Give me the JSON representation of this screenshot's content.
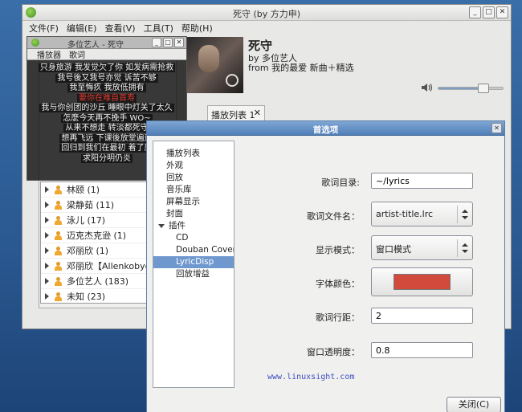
{
  "main_window": {
    "title": "死守 (by 方力申)",
    "menu": [
      "文件(F)",
      "编辑(E)",
      "查看(V)",
      "工具(T)",
      "帮助(H)"
    ],
    "now_playing": {
      "title": "死守",
      "artist": "by 多位艺人",
      "album": "from 我的最爱 新曲＋精选"
    },
    "volume_level": 0.7,
    "tab": {
      "label": "播放列表 1",
      "close": "✕"
    },
    "artists": [
      {
        "name": "林颐 (1)"
      },
      {
        "name": "梁静茹 (11)"
      },
      {
        "name": "泳儿 (17)"
      },
      {
        "name": "迈克杰克逊 (1)"
      },
      {
        "name": "邓丽欣 (1)"
      },
      {
        "name": "邓丽欣【Allenkoby@港"
      },
      {
        "name": "多位艺人 (183)"
      },
      {
        "name": "未知 (23)"
      }
    ]
  },
  "lyric_window": {
    "title": "多位艺人 - 死守",
    "menu": [
      "播放器",
      "歌词"
    ],
    "lines": [
      "只身旅游   我发觉欠了你   如发病需抢救",
      "我号後又我号亦觉   诉苦不够",
      "我至悔疚   我放低拥有",
      "要你在难自首寿",
      "我与你创团的沙丘   睡眼中灯关了太久",
      "怎麽今天再不挽手 WO~",
      "从来不想走   转淡都死守",
      "想再飞远   下课後放堂遍运",
      "回归到我们在最初   着了魔",
      "求阳分明仍炎"
    ],
    "current_line": 3
  },
  "preferences": {
    "title": "首选项",
    "nav": [
      {
        "label": "播放列表",
        "level": 1
      },
      {
        "label": "外观",
        "level": 1
      },
      {
        "label": "回放",
        "level": 1
      },
      {
        "label": "音乐库",
        "level": 1
      },
      {
        "label": "屏幕显示",
        "level": 1
      },
      {
        "label": "封面",
        "level": 1
      },
      {
        "label": "插件",
        "level": 0
      },
      {
        "label": "CD",
        "level": 2
      },
      {
        "label": "Douban Covers",
        "level": 2
      },
      {
        "label": "LyricDisp",
        "level": 2,
        "selected": true
      },
      {
        "label": "回放增益",
        "level": 2
      }
    ],
    "fields": {
      "lyrics_dir_label": "歌词目录:",
      "lyrics_dir_value": "~/lyrics",
      "lyrics_filename_label": "歌词文件名：",
      "lyrics_filename_value": "artist-title.lrc",
      "display_mode_label": "显示模式：",
      "display_mode_value": "窗口模式",
      "font_color_label": "字体颜色：",
      "font_color_value": "#d24a3c",
      "line_spacing_label": "歌词行距：",
      "line_spacing_value": "2",
      "opacity_label": "窗口透明度：",
      "opacity_value": "0.8"
    },
    "watermark": "www.linuxsight.com",
    "close_button": "关闭(C)"
  }
}
